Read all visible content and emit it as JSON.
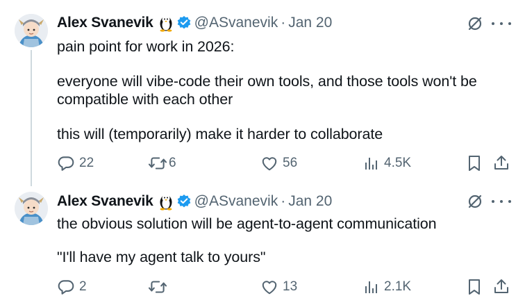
{
  "tweets": [
    {
      "author_name": "Alex Svanevik",
      "author_handle": "@ASvanevik",
      "separator": "·",
      "date": "Jan 20",
      "paragraphs": [
        "pain point for work in 2026:",
        "everyone will vibe-code their own tools, and those tools won't be compatible with each other",
        "this will (temporarily) make it harder to collaborate"
      ],
      "replies": "22",
      "reposts": "6",
      "likes": "56",
      "views": "4.5K"
    },
    {
      "author_name": "Alex Svanevik",
      "author_handle": "@ASvanevik",
      "separator": "·",
      "date": "Jan 20",
      "paragraphs": [
        "the obvious solution will be agent-to-agent communication",
        "\"I'll have my agent talk to yours\""
      ],
      "replies": "2",
      "reposts": "",
      "likes": "13",
      "views": "2.1K"
    }
  ],
  "icons": {
    "reply": "reply-icon",
    "repost": "repost-icon",
    "like": "heart-icon",
    "views": "analytics-icon",
    "bookmark": "bookmark-icon",
    "share": "share-icon",
    "grok": "grok-icon",
    "more": "more-icon",
    "badge": "verified-badge-icon",
    "emoji": "penguin-icon"
  },
  "colors": {
    "text": "#0f1419",
    "muted": "#536471",
    "verified": "#1d9bf0",
    "thread_line": "#cfd9de"
  }
}
